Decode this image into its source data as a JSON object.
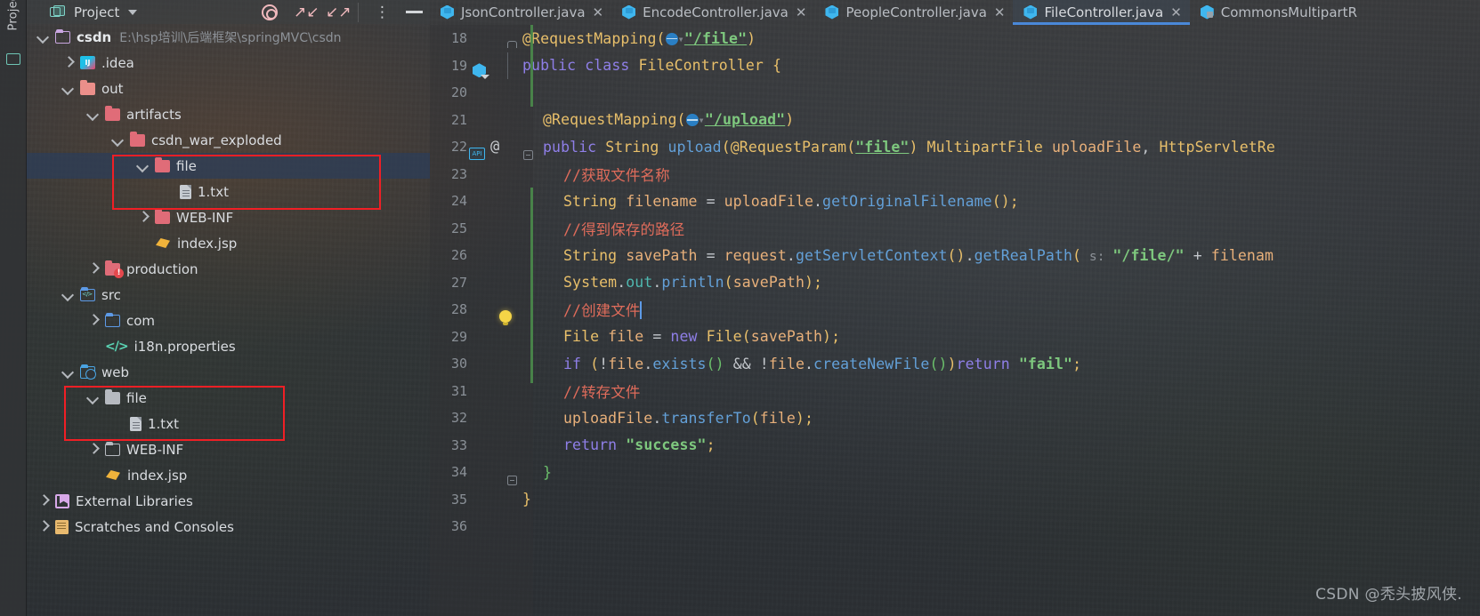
{
  "toolstrip": {
    "vertical_label": "Project",
    "structure_icon": "structure-icon"
  },
  "panel": {
    "title": "Project",
    "icons": {
      "project_icon": "project-icon",
      "dropdown": "chevron-down-icon",
      "locate": "target-icon",
      "expand_all": "expand-all-icon",
      "collapse_all": "collapse-all-icon",
      "options": "more-vertical-icon",
      "hide": "minimize-icon"
    }
  },
  "tree": [
    {
      "label": "csdn",
      "path": "E:\\hsp培训\\后端框架\\springMVC\\csdn",
      "icon": "folder-outline-purple",
      "arrow": "down",
      "indent": 0,
      "bold": true,
      "selected": false
    },
    {
      "label": ".idea",
      "path": "",
      "icon": "idea-module",
      "arrow": "right",
      "indent": 1,
      "bold": false,
      "selected": false
    },
    {
      "label": "out",
      "path": "",
      "icon": "folder-pink-light",
      "arrow": "down",
      "indent": 1,
      "bold": false,
      "selected": false
    },
    {
      "label": "artifacts",
      "path": "",
      "icon": "folder-pink",
      "arrow": "down",
      "indent": 2,
      "bold": false,
      "selected": false
    },
    {
      "label": "csdn_war_exploded",
      "path": "",
      "icon": "folder-pink",
      "arrow": "down",
      "indent": 3,
      "bold": false,
      "selected": false
    },
    {
      "label": "file",
      "path": "",
      "icon": "folder-pink",
      "arrow": "down",
      "indent": 4,
      "bold": false,
      "selected": true
    },
    {
      "label": "1.txt",
      "path": "",
      "icon": "text-file",
      "arrow": "none",
      "indent": 5,
      "bold": false,
      "selected": false
    },
    {
      "label": "WEB-INF",
      "path": "",
      "icon": "folder-pink",
      "arrow": "right",
      "indent": 4,
      "bold": false,
      "selected": false
    },
    {
      "label": "index.jsp",
      "path": "",
      "icon": "jsp-file",
      "arrow": "none",
      "indent": 4,
      "bold": false,
      "selected": false
    },
    {
      "label": "production",
      "path": "",
      "icon": "folder-pink-error",
      "arrow": "right",
      "indent": 2,
      "bold": false,
      "selected": false
    },
    {
      "label": "src",
      "path": "",
      "icon": "source-folder",
      "arrow": "down",
      "indent": 1,
      "bold": false,
      "selected": false
    },
    {
      "label": "com",
      "path": "",
      "icon": "folder-outline-blue",
      "arrow": "right",
      "indent": 2,
      "bold": false,
      "selected": false
    },
    {
      "label": "i18n.properties",
      "path": "",
      "icon": "properties-file",
      "arrow": "none",
      "indent": 2,
      "bold": false,
      "selected": false
    },
    {
      "label": "web",
      "path": "",
      "icon": "web-folder",
      "arrow": "down",
      "indent": 1,
      "bold": false,
      "selected": false
    },
    {
      "label": "file",
      "path": "",
      "icon": "folder-grey",
      "arrow": "down",
      "indent": 2,
      "bold": false,
      "selected": false
    },
    {
      "label": "1.txt",
      "path": "",
      "icon": "text-file",
      "arrow": "none",
      "indent": 3,
      "bold": false,
      "selected": false
    },
    {
      "label": "WEB-INF",
      "path": "",
      "icon": "folder-outline-grey",
      "arrow": "right",
      "indent": 2,
      "bold": false,
      "selected": false
    },
    {
      "label": "index.jsp",
      "path": "",
      "icon": "jsp-file",
      "arrow": "none",
      "indent": 2,
      "bold": false,
      "selected": false
    },
    {
      "label": "External Libraries",
      "path": "",
      "icon": "library-icon",
      "arrow": "right",
      "indent": 0,
      "bold": false,
      "selected": false
    },
    {
      "label": "Scratches and Consoles",
      "path": "",
      "icon": "scratches-icon",
      "arrow": "right",
      "indent": 0,
      "bold": false,
      "selected": false
    }
  ],
  "highlight_boxes": [
    {
      "name": "out-file-folder-highlight",
      "color": "#f01f25"
    },
    {
      "name": "web-file-folder-highlight",
      "color": "#f01f25"
    }
  ],
  "tabs": [
    {
      "label": "JsonController.java",
      "icon": "java-class-icon",
      "active": false,
      "closable": true
    },
    {
      "label": "EncodeController.java",
      "icon": "java-class-icon",
      "active": false,
      "closable": true
    },
    {
      "label": "PeopleController.java",
      "icon": "java-class-icon",
      "active": false,
      "closable": true
    },
    {
      "label": "FileController.java",
      "icon": "java-class-icon",
      "active": true,
      "closable": true
    },
    {
      "label": "CommonsMultipartR",
      "icon": "java-class-locked-icon",
      "active": false,
      "closable": false
    }
  ],
  "close_glyph": "✕",
  "editor": {
    "accent_color": "#4a88d8",
    "first_line": 18,
    "lines": [
      {
        "no": "18",
        "gutter": "fold-top"
      },
      {
        "no": "19",
        "gutter": "class-marker"
      },
      {
        "no": "20",
        "gutter": ""
      },
      {
        "no": "21",
        "gutter": ""
      },
      {
        "no": "22",
        "gutter": "api-and-at"
      },
      {
        "no": "23",
        "gutter": ""
      },
      {
        "no": "24",
        "gutter": ""
      },
      {
        "no": "25",
        "gutter": ""
      },
      {
        "no": "26",
        "gutter": ""
      },
      {
        "no": "27",
        "gutter": ""
      },
      {
        "no": "28",
        "gutter": "bulb"
      },
      {
        "no": "29",
        "gutter": ""
      },
      {
        "no": "30",
        "gutter": ""
      },
      {
        "no": "31",
        "gutter": ""
      },
      {
        "no": "32",
        "gutter": ""
      },
      {
        "no": "33",
        "gutter": ""
      },
      {
        "no": "34",
        "gutter": "fold-minus"
      },
      {
        "no": "35",
        "gutter": ""
      },
      {
        "no": "36",
        "gutter": ""
      }
    ],
    "code": {
      "l18_anno": "@RequestMapping(",
      "l18_str": "\"/file\"",
      "l18_end": ")",
      "l19": "public class FileController {",
      "l21_anno": "@RequestMapping(",
      "l21_str": "\"/upload\"",
      "l21_end": ")",
      "l22": "public String upload(@RequestParam(\"file\") MultipartFile uploadFile, HttpServletRe",
      "l23": "//获取文件名称",
      "l24": "String filename = uploadFile.getOriginalFilename();",
      "l25": "//得到保存的路径",
      "l26": "String savePath = request.getServletContext().getRealPath( s: \"/file/\" + filenam",
      "l27": "System.out.println(savePath);",
      "l28": "//创建文件",
      "l29": "File file = new File(savePath);",
      "l30": "if (!file.exists() && !file.createNewFile())return \"fail\";",
      "l31": "//转存文件",
      "l32": "uploadFile.transferTo(file);",
      "l33": "return \"success\";",
      "l34": "}",
      "l35": "}"
    }
  },
  "watermark": "CSDN @秃头披风侠."
}
